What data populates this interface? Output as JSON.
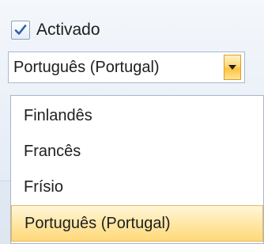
{
  "checkbox": {
    "label": "Activado",
    "checked": true
  },
  "language_combo": {
    "value": "Português (Portugal)"
  },
  "dropdown": {
    "options": [
      {
        "label": "Finlandês"
      },
      {
        "label": "Francês"
      },
      {
        "label": "Frísio"
      },
      {
        "label": "Português (Portugal)",
        "highlighted": true
      }
    ]
  },
  "colors": {
    "accent_highlight": "#ffd97a",
    "check_mark": "#2a5fb0"
  }
}
